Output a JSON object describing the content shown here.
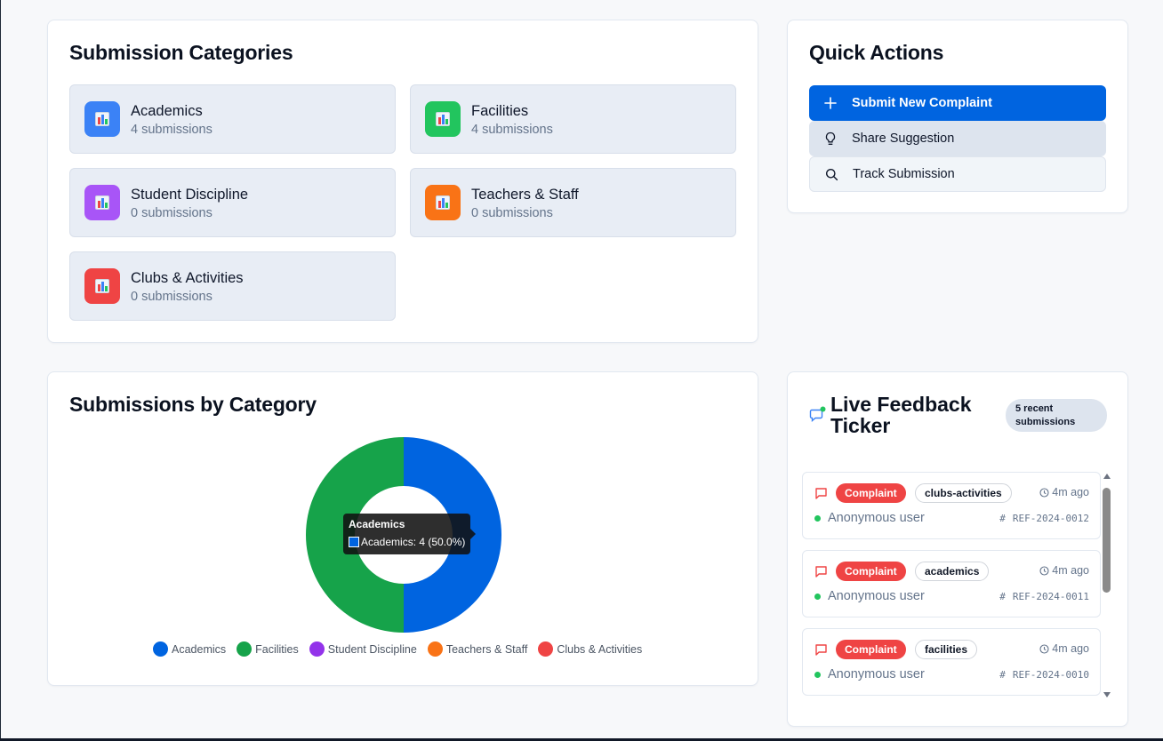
{
  "categories_card": {
    "title": "Submission Categories",
    "items": [
      {
        "name": "Academics",
        "count": "4 submissions",
        "color": "#3b82f6"
      },
      {
        "name": "Facilities",
        "count": "4 submissions",
        "color": "#22c55e"
      },
      {
        "name": "Student Discipline",
        "count": "0 submissions",
        "color": "#a855f7"
      },
      {
        "name": "Teachers & Staff",
        "count": "0 submissions",
        "color": "#f97316"
      },
      {
        "name": "Clubs & Activities",
        "count": "0 submissions",
        "color": "#ef4444"
      }
    ]
  },
  "quick_actions": {
    "title": "Quick Actions",
    "submit_label": "Submit New Complaint",
    "suggest_label": "Share Suggestion",
    "track_label": "Track Submission"
  },
  "chart_card": {
    "title": "Submissions by Category",
    "tooltip": {
      "title": "Academics",
      "body": "Academics: 4 (50.0%)"
    }
  },
  "chart_data": {
    "type": "pie",
    "donut": true,
    "categories": [
      "Academics",
      "Facilities",
      "Student Discipline",
      "Teachers & Staff",
      "Clubs & Activities"
    ],
    "values": [
      4,
      4,
      0,
      0,
      0
    ],
    "colors": [
      "#0064e0",
      "#16a34a",
      "#9333ea",
      "#f97316",
      "#ef4444"
    ],
    "legend_position": "bottom",
    "legend": [
      "Academics",
      "Facilities",
      "Student Discipline",
      "Teachers & Staff",
      "Clubs & Activities"
    ]
  },
  "live_feed": {
    "title_line1": "Live Feedback",
    "title_line2": "Ticker",
    "badge_line1": "5 recent",
    "badge_line2": "submissions",
    "items": [
      {
        "type": "Complaint",
        "category": "clubs-activities",
        "time": "4m ago",
        "user": "Anonymous user",
        "ref": "REF-2024-0012"
      },
      {
        "type": "Complaint",
        "category": "academics",
        "time": "4m ago",
        "user": "Anonymous user",
        "ref": "REF-2024-0011"
      },
      {
        "type": "Complaint",
        "category": "facilities",
        "time": "4m ago",
        "user": "Anonymous user",
        "ref": "REF-2024-0010"
      }
    ]
  }
}
